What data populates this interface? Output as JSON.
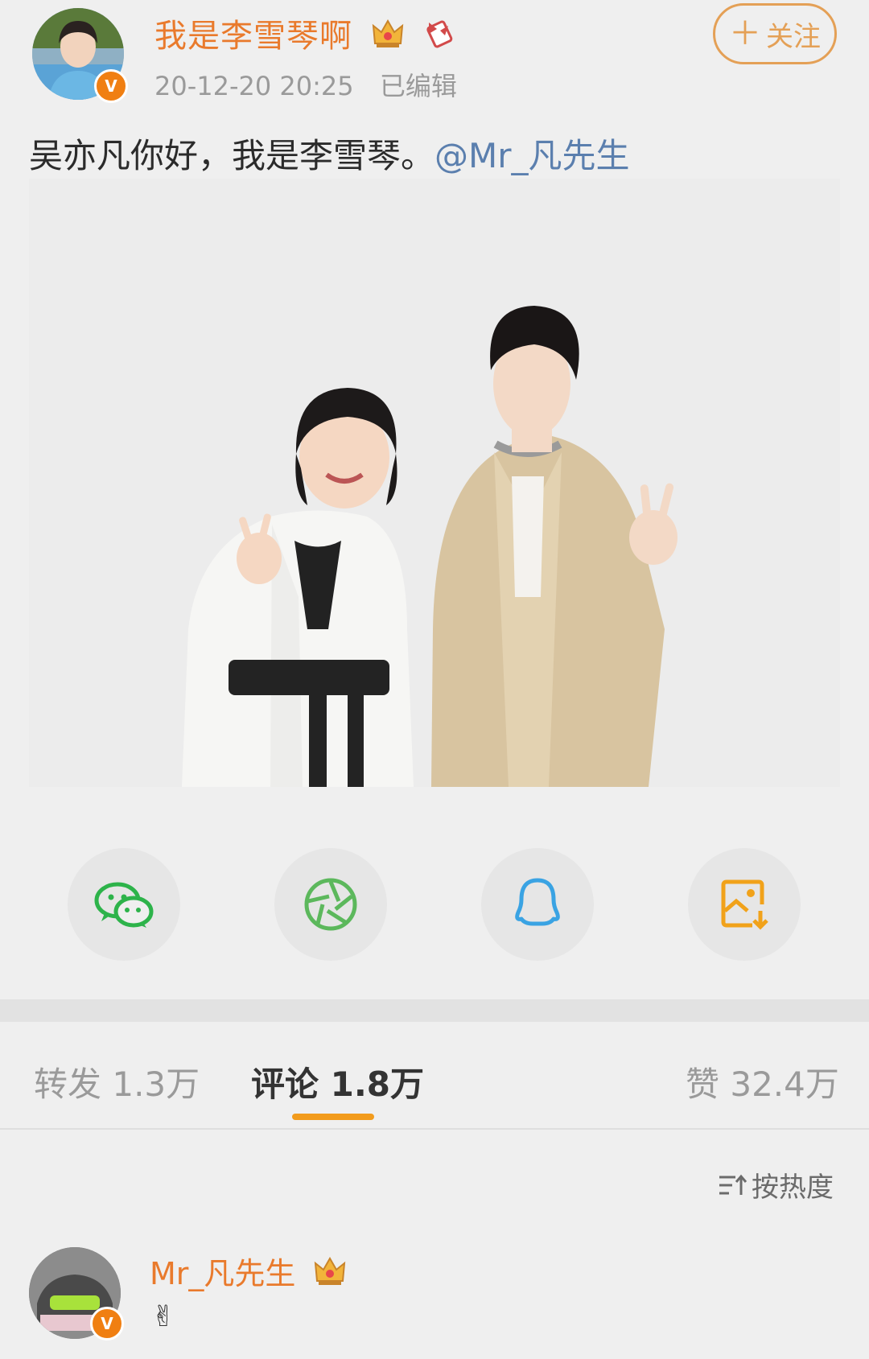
{
  "post": {
    "author_name": "我是李雪琴啊",
    "timestamp": "20-12-20 20:25",
    "edited_label": "已编辑",
    "follow_label": "关注",
    "follow_plus": "＋",
    "text": "吴亦凡你好，我是李雪琴。",
    "mention": "@Mr_凡先生",
    "verified_mark": "V"
  },
  "share_buttons": [
    {
      "icon": "wechat-icon",
      "color": "#2db34a"
    },
    {
      "icon": "moments-icon",
      "color": "#5cb85c"
    },
    {
      "icon": "qq-icon",
      "color": "#3aa3e3"
    },
    {
      "icon": "save-image-icon",
      "color": "#f1a21a"
    }
  ],
  "tabs": {
    "repost": "转发 1.3万",
    "comment": "评论 1.8万",
    "like": "赞 32.4万"
  },
  "sort": {
    "label": "按热度"
  },
  "comment": {
    "author": "Mr_凡先生",
    "text": "✌",
    "verified_mark": "V"
  },
  "colors": {
    "accent": "#f29b1c",
    "name": "#e97a2c",
    "mention": "#5b7fae"
  }
}
